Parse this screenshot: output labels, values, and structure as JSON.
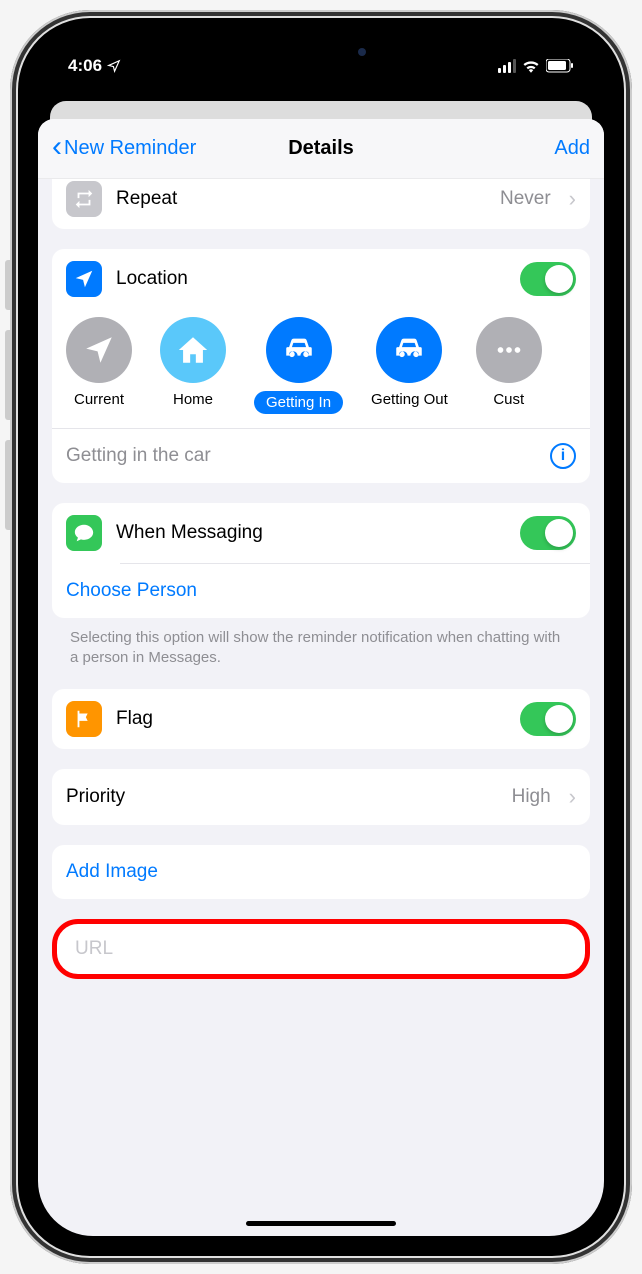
{
  "status": {
    "time": "4:06"
  },
  "nav": {
    "back": "New Reminder",
    "title": "Details",
    "add": "Add"
  },
  "repeat": {
    "label": "Repeat",
    "value": "Never"
  },
  "location": {
    "label": "Location",
    "chips": {
      "current": "Current",
      "home": "Home",
      "getting_in": "Getting In",
      "getting_out": "Getting Out",
      "custom": "Cust"
    },
    "detail": "Getting in the car"
  },
  "messaging": {
    "label": "When Messaging",
    "choose": "Choose Person",
    "hint": "Selecting this option will show the reminder notification when chatting with a person in Messages."
  },
  "flag": {
    "label": "Flag"
  },
  "priority": {
    "label": "Priority",
    "value": "High"
  },
  "add_image": "Add Image",
  "url": {
    "placeholder": "URL"
  }
}
